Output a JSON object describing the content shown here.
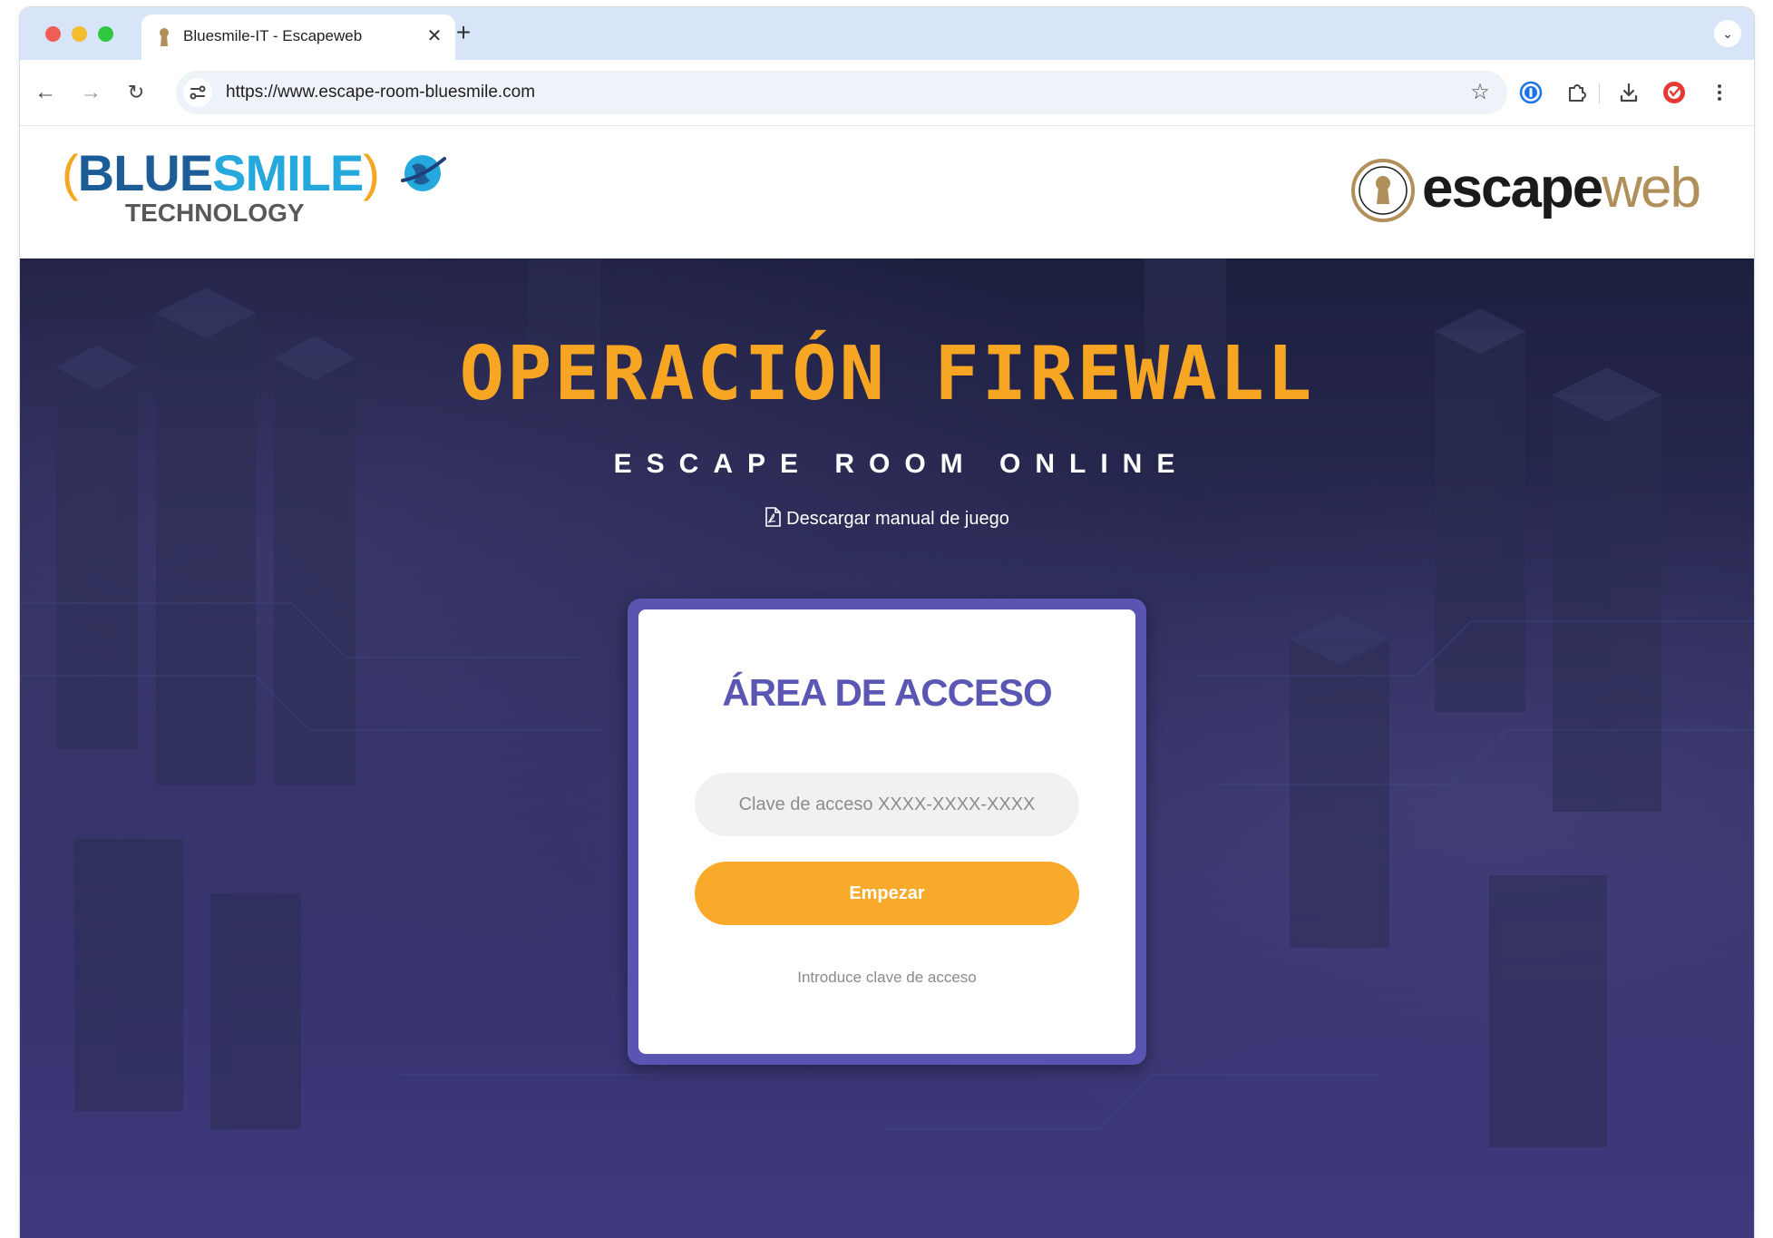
{
  "browser": {
    "tab": {
      "title": "Bluesmile-IT - Escapeweb",
      "close_glyph": "✕"
    },
    "new_tab_glyph": "+",
    "tab_menu_glyph": "⌄",
    "nav": {
      "back_glyph": "←",
      "forward_glyph": "→",
      "reload_glyph": "↻"
    },
    "address": {
      "url": "https://www.escape-room-bluesmile.com"
    },
    "bookmark_glyph": "☆",
    "icons": [
      "site-info-icon",
      "star-icon",
      "password-manager-icon",
      "extensions-icon",
      "download-icon",
      "profile-icon",
      "more-menu-icon"
    ]
  },
  "header": {
    "bluesmile_logo": {
      "paren_open": "(",
      "word_blue": "BLUE",
      "word_smile": "SMILE",
      "paren_close": ")",
      "subtitle": "TECHNOLOGY"
    },
    "escapeweb_logo": {
      "part_escape": "escape",
      "part_web": "web"
    }
  },
  "hero": {
    "title": "OPERACIÓN FIREWALL",
    "subtitle": "ESCAPE ROOM ONLINE",
    "manual_link": "Descargar manual de juego"
  },
  "login": {
    "title": "ÁREA DE ACCESO",
    "input_value": "",
    "input_placeholder": "Clave de acceso XXXX-XXXX-XXXX",
    "button_label": "Empezar",
    "hint": "Introduce clave de acceso"
  },
  "colors": {
    "accent_orange": "#f9aa2b",
    "title_orange": "#f7a623",
    "card_purple": "#5955b0",
    "hero_dark": "#1d1f3e",
    "tabbar": "#d8e4f7"
  }
}
